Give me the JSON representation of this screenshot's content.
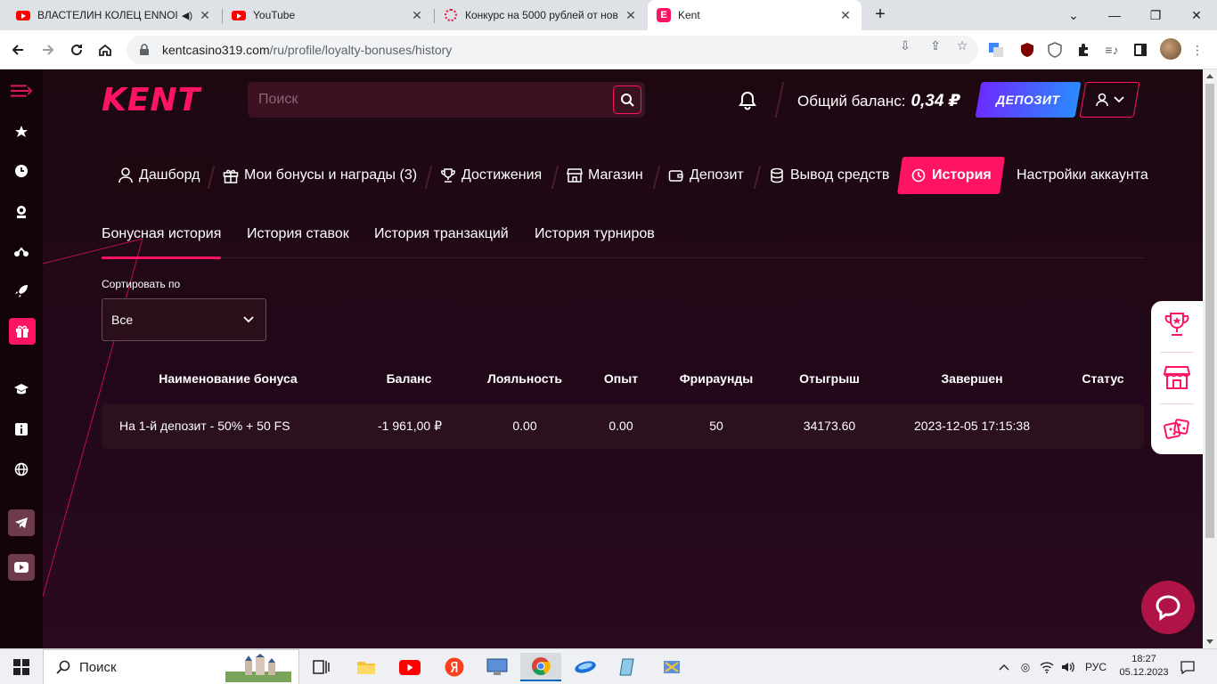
{
  "browser": {
    "tabs": [
      {
        "title": "ВЛАСТЕЛИН КОЛЕЦ ENNOI",
        "favicon": "youtube-icon",
        "audio": true
      },
      {
        "title": "YouTube",
        "favicon": "youtube-icon"
      },
      {
        "title": "Конкурс на 5000 рублей от нов",
        "favicon": "ring-icon"
      },
      {
        "title": "Kent",
        "favicon": "kent-icon",
        "active": true
      }
    ],
    "url_host": "kentcasino319.com",
    "url_path": "/ru/profile/loyalty-bonuses/history"
  },
  "header": {
    "logo": "KENT",
    "search_placeholder": "Поиск",
    "balance_label": "Общий баланс:",
    "balance_value": "0,34 ₽",
    "deposit_label": "ДЕПОЗИТ"
  },
  "profile_nav": [
    {
      "label": "Дашборд",
      "icon": "user-icon"
    },
    {
      "label": "Мои бонусы и награды (3)",
      "icon": "gift-icon"
    },
    {
      "label": "Достижения",
      "icon": "trophy-icon"
    },
    {
      "label": "Магазин",
      "icon": "store-icon"
    },
    {
      "label": "Депозит",
      "icon": "wallet-icon"
    },
    {
      "label": "Вывод средств",
      "icon": "coins-icon"
    },
    {
      "label": "История",
      "icon": "clock-icon",
      "active": true
    },
    {
      "label": "Настройки аккаунта",
      "icon": ""
    }
  ],
  "subtabs": [
    {
      "label": "Бонусная история",
      "active": true
    },
    {
      "label": "История ставок"
    },
    {
      "label": "История транзакций"
    },
    {
      "label": "История турниров"
    }
  ],
  "sort": {
    "label": "Сортировать по",
    "value": "Все"
  },
  "table": {
    "columns": [
      "Наименование бонуса",
      "Баланс",
      "Лояльность",
      "Опыт",
      "Фрираунды",
      "Отыгрыш",
      "Завершен",
      "Статус"
    ],
    "rows": [
      [
        "На 1-й депозит - 50% + 50 FS",
        "-1 961,00 ₽",
        "0.00",
        "0.00",
        "50",
        "34173.60",
        "2023-12-05 17:15:38",
        ""
      ]
    ]
  },
  "taskbar": {
    "search_label": "Поиск",
    "lang": "РУС",
    "time": "18:27",
    "date": "05.12.2023"
  },
  "colors": {
    "accent": "#ff1464",
    "background": "#1d0812",
    "deposit_gradient_start": "#6c2bff",
    "deposit_gradient_end": "#2b8bff"
  }
}
